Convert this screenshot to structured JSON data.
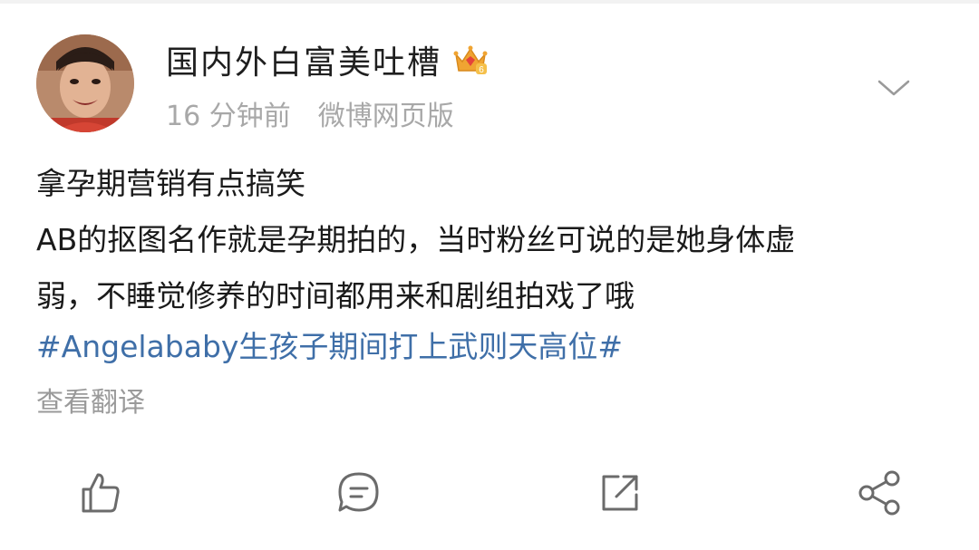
{
  "post": {
    "username": "国内外白富美吐槽",
    "time_ago": "16 分钟前",
    "source": "微博网页版",
    "lines": [
      "拿孕期营销有点搞笑",
      "AB的抠图名作就是孕期拍的，当时粉丝可说的是她身体虚",
      "弱，不睡觉修养的时间都用来和剧组拍戏了哦"
    ],
    "hashtag": "#Angelababy生孩子期间打上武则天高位#",
    "translate_label": "查看翻译",
    "badge_level": "6"
  },
  "actions": {
    "items": [
      {
        "name": "like",
        "icon": "thumbs-up-icon"
      },
      {
        "name": "comment",
        "icon": "comment-icon"
      },
      {
        "name": "repost",
        "icon": "repost-icon"
      },
      {
        "name": "share",
        "icon": "share-icon"
      }
    ]
  },
  "colors": {
    "hashtag": "#3f6fa8",
    "meta": "#a8a8a8",
    "icon": "#6b6b6b",
    "crown_gold": "#f0a432",
    "crown_red": "#e4433b"
  }
}
